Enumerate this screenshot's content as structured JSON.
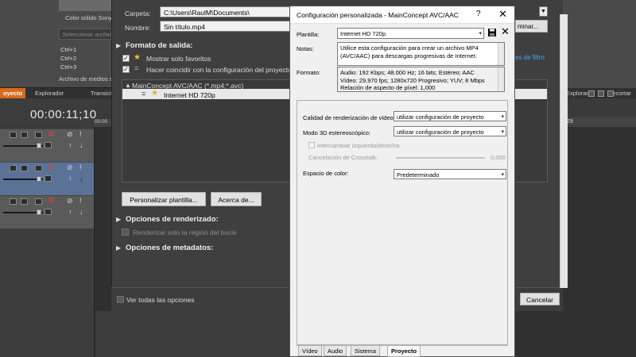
{
  "vegas": {
    "solid_color_label": "Color sólido Sony",
    "search_placeholder": "Seleccionar archivo",
    "ctrl_items": [
      "Ctrl+1",
      "Ctrl+2",
      "Ctrl+3"
    ],
    "media_label": "Archivo de medios si",
    "tabs": {
      "proyecto": "oyecto",
      "explorador": "Explorador",
      "transiciones": "Transicion",
      "explorador_right": "Explorador",
      "recortar": "Recortar"
    },
    "timecode": "00:00:11;10",
    "ruler_left": "00:00",
    "ruler_right": "29",
    "filter_link": "es de filtro",
    "eliminar_label": "minar...",
    "accent": "#d66a1a"
  },
  "render_dialog": {
    "carpeta_label": "Carpeta:",
    "carpeta_value": "C:\\Users\\RaulM\\Documents\\",
    "nombre_label": "Nombre:",
    "nombre_value": "Sin título.mp4",
    "output_format_heading": "Formato de salida:",
    "show_favorites_label": "Mostrar solo favoritos",
    "match_project_label": "Hacer coincidir con la configuración del proyecto",
    "tree_parent": "MainConcept AVC/AAC (*.mp4;*.avc)",
    "tree_child": "Internet HD 720p",
    "customize_button": "Personalizar plantilla...",
    "about_button": "Acerca de...",
    "render_options_heading": "Opciones de renderizado:",
    "render_loop_label": "Renderizar solo la región del bucle",
    "metadata_heading": "Opciones de metadatos:",
    "show_all_label": "Ver todas las opciones",
    "cancel_button": "Cancelar"
  },
  "custom_dialog": {
    "title": "Configuración personalizada - MainConcept AVC/AAC",
    "help": "?",
    "close": "✕",
    "template_label": "Plantilla:",
    "template_value": "Internet HD 720p",
    "notes_label": "Notas:",
    "notes_value": "Utilice esta configuración para crear un archivo MP4 (AVC/AAC) para descargas progresivas de Internet.",
    "format_label": "Formato:",
    "format_lines": [
      "Audio: 192 Kbps; 48.000 Hz; 16 bits; Estéreo; AAC",
      "Vídeo: 29,970 fps; 1280x720 Progresivo; YUV; 8 Mbps",
      "Relación de aspecto de píxel: 1,000"
    ],
    "quality_label": "Calidad de renderización de vídeo:",
    "quality_value": "utilizar configuración de proyecto",
    "stereo_label": "Modo 3D estereoscópico:",
    "stereo_value": "utilizar configuración de proyecto",
    "swap_label": "Intercambiar izquierda/derecha",
    "crosstalk_label": "Cancelación de Crosstalk:",
    "crosstalk_value": "0,000",
    "colorspace_label": "Espacio de color:",
    "colorspace_value": "Predeterminado",
    "tabs": [
      "Vídeo",
      "Audio",
      "Sistema",
      "Proyecto"
    ]
  }
}
